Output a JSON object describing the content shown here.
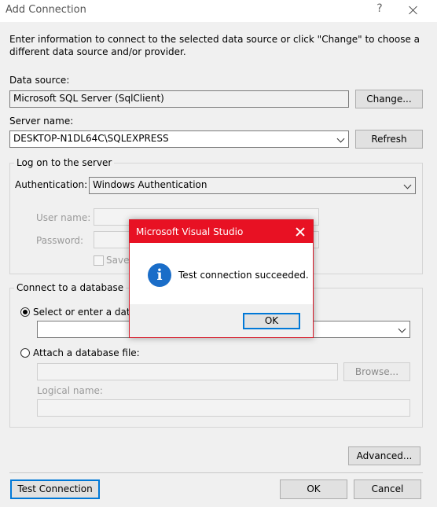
{
  "window": {
    "title": "Add Connection",
    "help_glyph": "?"
  },
  "intro_text": "Enter information to connect to the selected data source or click \"Change\" to choose a different data source and/or provider.",
  "data_source": {
    "label": "Data source:",
    "value": "Microsoft SQL Server (SqlClient)",
    "change_label": "Change..."
  },
  "server": {
    "label": "Server name:",
    "value": "DESKTOP-N1DL64C\\SQLEXPRESS",
    "refresh_label": "Refresh"
  },
  "logon": {
    "group_label": "Log on to the server",
    "auth_label": "Authentication:",
    "auth_value": "Windows Authentication",
    "user_label": "User name:",
    "password_label": "Password:",
    "save_label": "Save"
  },
  "database": {
    "group_label": "Connect to a database",
    "select_label": "Select or enter a databa",
    "attach_label": "Attach a database file:",
    "browse_label": "Browse...",
    "logical_label": "Logical name:"
  },
  "buttons": {
    "advanced": "Advanced...",
    "test": "Test Connection",
    "ok": "OK",
    "cancel": "Cancel"
  },
  "message_box": {
    "title": "Microsoft Visual Studio",
    "message": "Test connection succeeded.",
    "ok_label": "OK",
    "info_glyph": "i",
    "accent": "#e81123",
    "icon": "info-icon"
  }
}
